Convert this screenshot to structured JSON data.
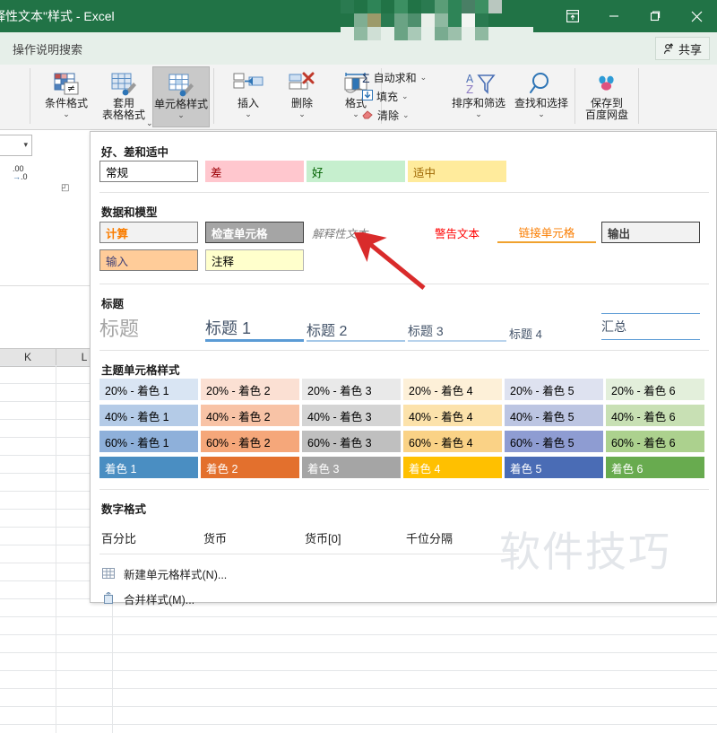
{
  "window": {
    "title": "释性文本\"样式 - Excel",
    "buttons": {
      "ribbon_display": "功能区显示选项",
      "minimize": "最小化",
      "restore": "向下还原",
      "close": "关闭"
    }
  },
  "tellme": {
    "placeholder": "操作说明搜索"
  },
  "share": {
    "label": "共享",
    "icon": "share-person-icon"
  },
  "ribbon": {
    "groups": [
      {
        "name": "styles",
        "buttons": [
          {
            "id": "conditional-formatting",
            "label": "条件格式",
            "label2": "",
            "has_caret": true,
            "active": false,
            "icon": "conditional-formatting-icon"
          },
          {
            "id": "format-as-table",
            "label": "套用",
            "label2": "表格格式",
            "has_caret": true,
            "active": false,
            "icon": "format-as-table-icon"
          },
          {
            "id": "cell-styles",
            "label": "单元格样式",
            "label2": "",
            "has_caret": true,
            "active": true,
            "icon": "cell-styles-icon"
          }
        ]
      },
      {
        "name": "cells",
        "buttons": [
          {
            "id": "insert",
            "label": "插入",
            "label2": "",
            "has_caret": true,
            "active": false,
            "icon": "insert-cells-icon"
          },
          {
            "id": "delete",
            "label": "删除",
            "label2": "",
            "has_caret": true,
            "active": false,
            "icon": "delete-cells-icon"
          },
          {
            "id": "format",
            "label": "格式",
            "label2": "",
            "has_caret": true,
            "active": false,
            "icon": "format-cells-icon"
          }
        ]
      },
      {
        "name": "editing",
        "small_buttons": [
          {
            "id": "autosum",
            "label": "自动求和",
            "icon": "sigma-icon",
            "has_caret": true
          },
          {
            "id": "fill",
            "label": "填充",
            "icon": "fill-down-icon",
            "has_caret": true
          },
          {
            "id": "clear",
            "label": "清除",
            "icon": "eraser-icon",
            "has_caret": true
          }
        ],
        "buttons": [
          {
            "id": "sort-filter",
            "label": "排序和筛选",
            "label2": "",
            "has_caret": true,
            "active": false,
            "icon": "sort-filter-icon"
          },
          {
            "id": "find-select",
            "label": "查找和选择",
            "label2": "",
            "has_caret": true,
            "active": false,
            "icon": "magnifier-icon"
          }
        ]
      },
      {
        "name": "baidu",
        "buttons": [
          {
            "id": "save-to-baidu",
            "label": "保存到",
            "label2": "百度网盘",
            "has_caret": false,
            "active": false,
            "icon": "baidu-netdisk-icon"
          }
        ]
      }
    ]
  },
  "sheet": {
    "column_headers": [
      "K",
      "L"
    ],
    "decimal_hint": ".00",
    "decimal_hint2": ".0"
  },
  "gallery": {
    "sections": [
      {
        "id": "good-bad-neutral",
        "title": "好、差和适中",
        "items": [
          {
            "label": "常规",
            "bg": "#ffffff",
            "fg": "#000000",
            "border": "#7f7f7f"
          },
          {
            "label": "差",
            "bg": "#ffc7ce",
            "fg": "#9c0006",
            "border": ""
          },
          {
            "label": "好",
            "bg": "#c6efce",
            "fg": "#006100",
            "border": ""
          },
          {
            "label": "适中",
            "bg": "#ffeb9c",
            "fg": "#9c6500",
            "border": ""
          }
        ]
      },
      {
        "id": "data-and-model",
        "title": "数据和模型",
        "items": [
          {
            "label": "计算",
            "bg": "#f2f2f2",
            "fg": "#fa7d00",
            "border": "#7f7f7f",
            "bold": true
          },
          {
            "label": "检查单元格",
            "bg": "#a5a5a5",
            "fg": "#ffffff",
            "border": "#3f3f3f",
            "bold": true
          },
          {
            "label": "解释性文本",
            "bg": "",
            "fg": "#7f7f7f",
            "border": "",
            "italic": true
          },
          {
            "label": "警告文本",
            "bg": "",
            "fg": "#ff0000",
            "border": ""
          },
          {
            "label": "链接单元格",
            "bg": "",
            "fg": "#fa7d00",
            "border": "",
            "underline_color": "#f0a22e"
          },
          {
            "label": "输出",
            "bg": "#f2f2f2",
            "fg": "#3f3f3f",
            "border": "#3f3f3f",
            "bold": true
          },
          {
            "label": "输入",
            "bg": "#ffcc99",
            "fg": "#3f3f76",
            "border": "#7f7f7f"
          },
          {
            "label": "注释",
            "bg": "#ffffcc",
            "fg": "#000000",
            "border": "#b2b2b2"
          }
        ]
      },
      {
        "id": "titles-and-headings",
        "title": "标题",
        "items": [
          {
            "label": "标题",
            "fg": "#a6a6a6",
            "size": 22,
            "underline_color": "",
            "underline_h": 0
          },
          {
            "label": "标题 1",
            "fg": "#44546a",
            "size": 18,
            "underline_color": "#5b9bd5",
            "underline_h": 3
          },
          {
            "label": "标题 2",
            "fg": "#44546a",
            "size": 16,
            "underline_color": "#a5c8e8",
            "underline_h": 2
          },
          {
            "label": "标题 3",
            "fg": "#44546a",
            "size": 14,
            "underline_color": "#b9d3ec",
            "underline_h": 2
          },
          {
            "label": "标题 4",
            "fg": "#44546a",
            "size": 13,
            "underline_color": "",
            "underline_h": 0
          },
          {
            "label": "汇总",
            "fg": "#44546a",
            "size": 14,
            "underline_color": "#5b9bd5",
            "underline_h": 1,
            "double_rule": true
          }
        ]
      },
      {
        "id": "themed-cell-styles",
        "title": "主题单元格样式",
        "rows": [
          [
            {
              "label": "20% - 着色 1",
              "bg": "#d9e5f3",
              "fg": "#000000"
            },
            {
              "label": "20% - 着色 2",
              "bg": "#fbe0d3",
              "fg": "#000000"
            },
            {
              "label": "20% - 着色 3",
              "bg": "#e9e9e9",
              "fg": "#000000"
            },
            {
              "label": "20% - 着色 4",
              "bg": "#fdf0d8",
              "fg": "#000000"
            },
            {
              "label": "20% - 着色 5",
              "bg": "#dee2f0",
              "fg": "#000000"
            },
            {
              "label": "20% - 着色 6",
              "bg": "#e3efdb",
              "fg": "#000000"
            }
          ],
          [
            {
              "label": "40% - 着色 1",
              "bg": "#b4cbe7",
              "fg": "#000000"
            },
            {
              "label": "40% - 着色 2",
              "bg": "#f8c3a6",
              "fg": "#000000"
            },
            {
              "label": "40% - 着色 3",
              "bg": "#d4d4d4",
              "fg": "#000000"
            },
            {
              "label": "40% - 着色 4",
              "bg": "#fce2ab",
              "fg": "#000000"
            },
            {
              "label": "40% - 着色 5",
              "bg": "#bcc5e2",
              "fg": "#000000"
            },
            {
              "label": "40% - 着色 6",
              "bg": "#c8e0b4",
              "fg": "#000000"
            }
          ],
          [
            {
              "label": "60% - 着色 1",
              "bg": "#8eb0da",
              "fg": "#000000"
            },
            {
              "label": "60% - 着色 2",
              "bg": "#f5a77a",
              "fg": "#000000"
            },
            {
              "label": "60% - 着色 3",
              "bg": "#bfbfbf",
              "fg": "#000000"
            },
            {
              "label": "60% - 着色 4",
              "bg": "#fad286",
              "fg": "#000000"
            },
            {
              "label": "60% - 着色 5",
              "bg": "#8e9cd2",
              "fg": "#000000"
            },
            {
              "label": "60% - 着色 6",
              "bg": "#acd18e",
              "fg": "#000000"
            }
          ],
          [
            {
              "label": "着色 1",
              "bg": "#4a8ec2",
              "fg": "#ffffff"
            },
            {
              "label": "着色 2",
              "bg": "#e3702d",
              "fg": "#ffffff"
            },
            {
              "label": "着色 3",
              "bg": "#a5a5a5",
              "fg": "#ffffff"
            },
            {
              "label": "着色 4",
              "bg": "#ffc000",
              "fg": "#ffffff"
            },
            {
              "label": "着色 5",
              "bg": "#4a6cb5",
              "fg": "#ffffff"
            },
            {
              "label": "着色 6",
              "bg": "#68ab4f",
              "fg": "#ffffff"
            }
          ]
        ]
      },
      {
        "id": "number-format",
        "title": "数字格式",
        "items": [
          {
            "label": "百分比"
          },
          {
            "label": "货币"
          },
          {
            "label": "货币[0]"
          },
          {
            "label": "千位分隔"
          }
        ]
      }
    ],
    "menu": [
      {
        "id": "new-cell-style",
        "label": "新建单元格样式(N)...",
        "icon": "new-cell-style-icon"
      },
      {
        "id": "merge-styles",
        "label": "合并样式(M)...",
        "icon": "merge-styles-icon"
      }
    ]
  },
  "watermark": {
    "text": "软件技巧"
  },
  "annotation": {
    "arrow": "red-arrow-pointing-to-explanatory-text",
    "color": "#d92b2b"
  }
}
